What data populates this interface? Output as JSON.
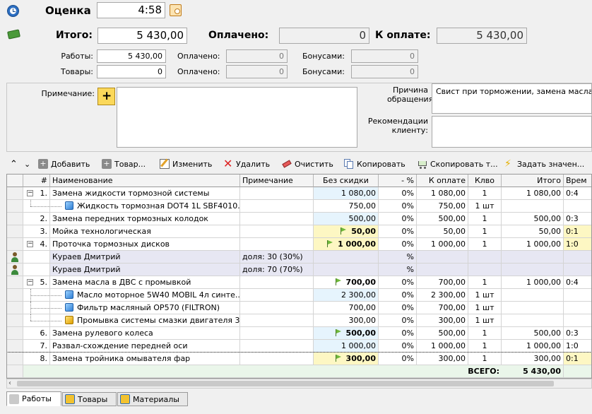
{
  "estimate": {
    "label": "Оценка",
    "value": "4:58"
  },
  "totals": {
    "total_label": "Итого:",
    "total_value": "5 430,00",
    "paid_label": "Оплачено:",
    "paid_value": "0",
    "due_label": "К оплате:",
    "due_value": "5 430,00"
  },
  "breakdown": {
    "works_label": "Работы:",
    "works_value": "5 430,00",
    "goods_label": "Товары:",
    "goods_value": "0",
    "paid_label": "Оплачено:",
    "works_paid": "0",
    "goods_paid": "0",
    "bonus_label": "Бонусами:",
    "works_bonus": "0",
    "goods_bonus": "0"
  },
  "notes": {
    "note_label": "Примечание:",
    "reason_label": "Причина обращения:",
    "reason_value": "Свист при торможении, замена масла",
    "recommend_label": "Рекомендации клиенту:",
    "recommend_value": ""
  },
  "toolbar": {
    "add": "Добавить",
    "goods": "Товар...",
    "edit": "Изменить",
    "delete": "Удалить",
    "clear": "Очистить",
    "copy": "Копировать",
    "copy_to": "Скопировать т...",
    "set_value": "Задать значен..."
  },
  "grid": {
    "columns": [
      "#",
      "Наименование",
      "Примечание",
      "Без скидки",
      "- %",
      "К оплате",
      "Клво",
      "Итого",
      "Врем"
    ],
    "rows": [
      {
        "num": "1.",
        "name": "Замена жидкости тормозной системы",
        "note": "",
        "base": "1 080,00",
        "disc": "0%",
        "pay": "1 080,00",
        "qty": "1",
        "total": "1 080,00",
        "time": "0:4"
      },
      {
        "num": "",
        "name": "Жидкость тормозная DOT4 1L SBF4010...",
        "note": "",
        "base": "750,00",
        "disc": "0%",
        "pay": "750,00",
        "qty": "1 шт",
        "total": "",
        "time": ""
      },
      {
        "num": "2.",
        "name": "Замена передних тормозных колодок",
        "note": "",
        "base": "500,00",
        "disc": "0%",
        "pay": "500,00",
        "qty": "1",
        "total": "500,00",
        "time": "0:3"
      },
      {
        "num": "3.",
        "name": "Мойка технологическая",
        "note": "",
        "base": "50,00",
        "disc": "0%",
        "pay": "50,00",
        "qty": "1",
        "total": "50,00",
        "time": "0:1"
      },
      {
        "num": "4.",
        "name": "Проточка тормозных дисков",
        "note": "",
        "base": "1 000,00",
        "disc": "0%",
        "pay": "1 000,00",
        "qty": "1",
        "total": "1 000,00",
        "time": "1:0"
      },
      {
        "num": "",
        "name": "Кураев Дмитрий",
        "note": "доля: 30 (30%)",
        "base": "",
        "disc": "%",
        "pay": "",
        "qty": "",
        "total": "",
        "time": ""
      },
      {
        "num": "",
        "name": "Кураев Дмитрий",
        "note": "доля: 70 (70%)",
        "base": "",
        "disc": "%",
        "pay": "",
        "qty": "",
        "total": "",
        "time": ""
      },
      {
        "num": "5.",
        "name": "Замена масла в ДВС с промывкой",
        "note": "",
        "base": "700,00",
        "disc": "0%",
        "pay": "700,00",
        "qty": "1",
        "total": "1 000,00",
        "time": "0:4"
      },
      {
        "num": "",
        "name": "Масло моторное 5W40 MOBIL 4л синте...",
        "note": "",
        "base": "2 300,00",
        "disc": "0%",
        "pay": "2 300,00",
        "qty": "1 шт",
        "total": "",
        "time": ""
      },
      {
        "num": "",
        "name": "Фильтр масляный OP570 (FILTRON)",
        "note": "",
        "base": "700,00",
        "disc": "0%",
        "pay": "700,00",
        "qty": "1 шт",
        "total": "",
        "time": ""
      },
      {
        "num": "",
        "name": "Промывка системы смазки двигателя 3...",
        "note": "",
        "base": "300,00",
        "disc": "0%",
        "pay": "300,00",
        "qty": "1 шт",
        "total": "",
        "time": ""
      },
      {
        "num": "6.",
        "name": "Замена рулевого колеса",
        "note": "",
        "base": "500,00",
        "disc": "0%",
        "pay": "500,00",
        "qty": "1",
        "total": "500,00",
        "time": "0:3"
      },
      {
        "num": "7.",
        "name": "Развал-схождение передней оси",
        "note": "",
        "base": "1 000,00",
        "disc": "0%",
        "pay": "1 000,00",
        "qty": "1",
        "total": "1 000,00",
        "time": "1:0"
      },
      {
        "num": "8.",
        "name": "Замена тройника омывателя фар",
        "note": "",
        "base": "300,00",
        "disc": "0%",
        "pay": "300,00",
        "qty": "1",
        "total": "300,00",
        "time": "0:1"
      }
    ],
    "footer_label": "ВСЕГО:",
    "footer_total": "5 430,00"
  },
  "tabs": [
    "Работы",
    "Товары",
    "Материалы"
  ],
  "colors": {
    "row_blue": "#e6f4fd",
    "row_yellow": "#fdf7c3",
    "row_employee": "#e7e7f3",
    "flag": "#6fb83a"
  }
}
